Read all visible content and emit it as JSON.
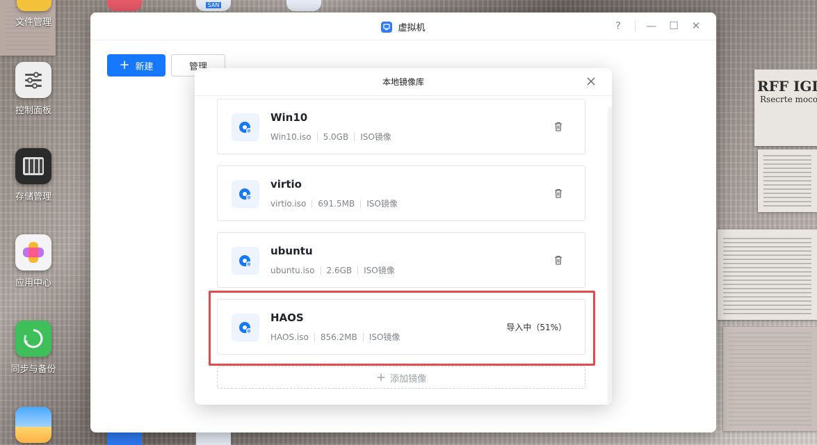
{
  "desktop": {
    "icons": [
      {
        "label": "文件管理",
        "icon": "folder-icon"
      },
      {
        "label": "控制面板",
        "icon": "sliders-icon"
      },
      {
        "label": "存储管理",
        "icon": "storage-icon"
      },
      {
        "label": "应用中心",
        "icon": "app-center-icon"
      },
      {
        "label": "同步与备份",
        "icon": "sync-icon"
      },
      {
        "label": "",
        "icon": "photos-icon"
      }
    ],
    "top_icon_labels": {
      "san": "SAN"
    },
    "wallpaper_text": {
      "headline": "RFF IGL",
      "subline": "Rsecrte moco"
    }
  },
  "window": {
    "title": "虚拟机",
    "controls": {
      "help": "?",
      "minimize": "—",
      "maximize": "☐",
      "close": "✕"
    },
    "toolbar": {
      "new_label": "新建",
      "manage_label": "管理"
    }
  },
  "modal": {
    "title": "本地镜像库",
    "items": [
      {
        "name": "Win10",
        "file": "Win10.iso",
        "size": "5.0GB",
        "type": "ISO镜像",
        "status": ""
      },
      {
        "name": "virtio",
        "file": "virtio.iso",
        "size": "691.5MB",
        "type": "ISO镜像",
        "status": ""
      },
      {
        "name": "ubuntu",
        "file": "ubuntu.iso",
        "size": "2.6GB",
        "type": "ISO镜像",
        "status": ""
      },
      {
        "name": "HAOS",
        "file": "HAOS.iso",
        "size": "856.2MB",
        "type": "ISO镜像",
        "status": "导入中（51%）"
      }
    ],
    "add_label": "添加镜像"
  },
  "colors": {
    "accent": "#1677ff",
    "highlight": "#e5484d"
  }
}
